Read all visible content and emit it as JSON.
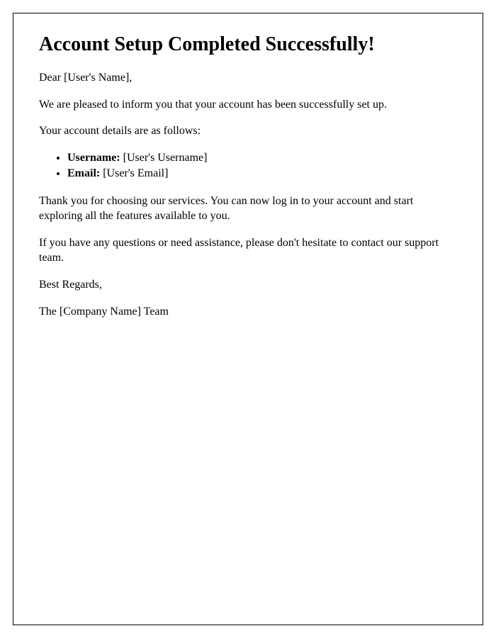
{
  "heading": "Account Setup Completed Successfully!",
  "greeting": "Dear [User's Name],",
  "intro": "We are pleased to inform you that your account has been successfully set up.",
  "details_intro": "Your account details are as follows:",
  "details": {
    "username_label": "Username:",
    "username_value": " [User's Username]",
    "email_label": "Email:",
    "email_value": " [User's Email]"
  },
  "thankyou": "Thank you for choosing our services. You can now log in to your account and start exploring all the features available to you.",
  "support": "If you have any questions or need assistance, please don't hesitate to contact our support team.",
  "signoff": "Best Regards,",
  "team": "The [Company Name] Team"
}
